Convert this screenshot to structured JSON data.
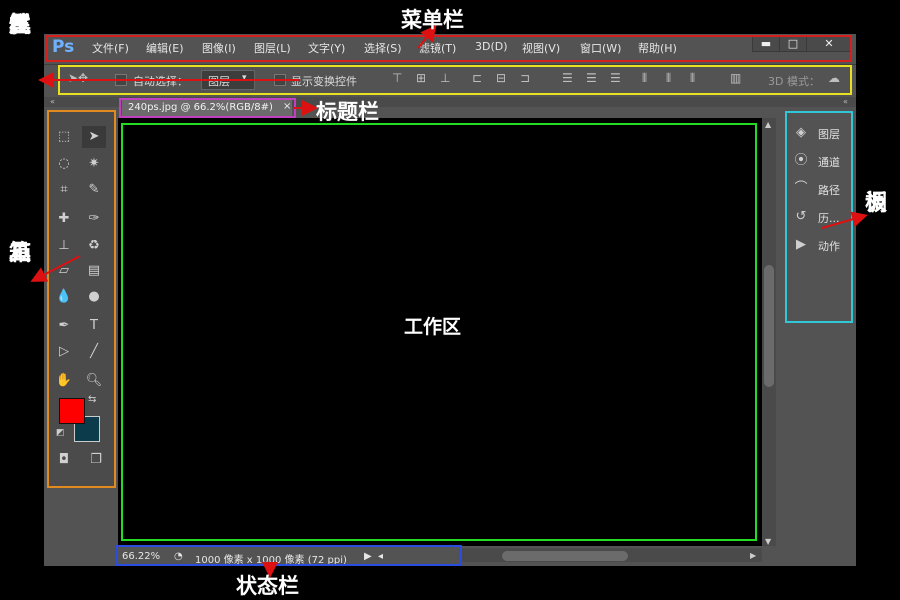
{
  "annotations": {
    "menubar": "菜单栏",
    "options_bar_chars": [
      "工",
      "具",
      "属",
      "性",
      "栏"
    ],
    "title_bar": "标题栏",
    "toolbox_chars": [
      "工",
      "具",
      "箱"
    ],
    "work_area": "工作区",
    "panel_chars": [
      "调",
      "板"
    ],
    "status_bar": "状态栏"
  },
  "app": {
    "logo": "Ps"
  },
  "menu": {
    "items": [
      "文件(F)",
      "编辑(E)",
      "图像(I)",
      "图层(L)",
      "文字(Y)",
      "选择(S)",
      "滤镜(T)",
      "3D(D)",
      "视图(V)",
      "窗口(W)",
      "帮助(H)"
    ],
    "minimize": "▬",
    "maximize": "□",
    "close": "✕"
  },
  "options_bar": {
    "auto_select_label": "自动选择：",
    "auto_select_value": "图层",
    "show_transform_label": "显示变换控件",
    "mode_3d_label": "3D 模式："
  },
  "document": {
    "tab_title": "240ps.jpg @ 66.2%(RGB/8#)",
    "close": "×"
  },
  "panels": [
    {
      "label": "图层",
      "icon": "layers-icon"
    },
    {
      "label": "通道",
      "icon": "channels-icon"
    },
    {
      "label": "路径",
      "icon": "paths-icon"
    },
    {
      "label": "历...",
      "icon": "history-icon"
    },
    {
      "label": "动作",
      "icon": "actions-icon"
    }
  ],
  "status": {
    "zoom": "66.22%",
    "doc_info": "1000 像素 x 1000 像素 (72 ppi)"
  },
  "colors": {
    "foreground": "#ff0000",
    "background": "#0c3b4c",
    "menubar_box": "#d62020",
    "options_box": "#e8e020",
    "title_box": "#c040c0",
    "toolbox_box": "#e08a20",
    "workarea_box": "#22dd22",
    "panel_box": "#30c8d8",
    "status_box": "#2a4ce0",
    "arrow": "#dd1111"
  }
}
